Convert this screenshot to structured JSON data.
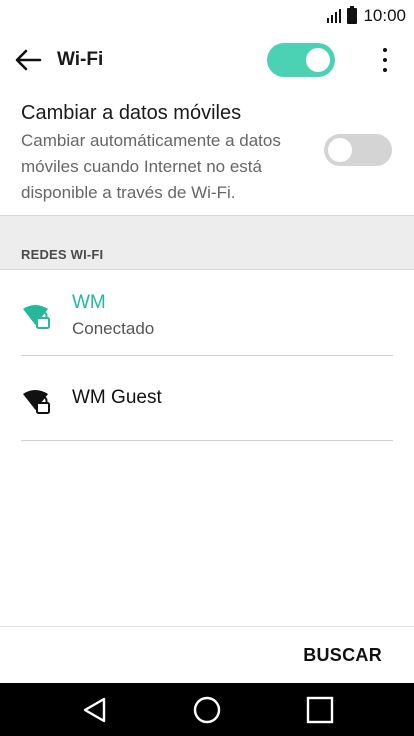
{
  "status_bar": {
    "time": "10:00",
    "icons": [
      "signal-icon",
      "battery-icon"
    ]
  },
  "app_bar": {
    "title": "Wi-Fi",
    "wifi_toggle_on": true,
    "icons": [
      "back-arrow-icon",
      "more-vert-icon"
    ]
  },
  "mobile_data_switch": {
    "title": "Cambiar a datos móviles",
    "description": "Cambiar automáticamente a datos móviles cuando Internet no está disponible a través de Wi-Fi.",
    "enabled": false
  },
  "section": {
    "header": "REDES WI-FI"
  },
  "networks": [
    {
      "name": "WM",
      "status": "Conectado",
      "connected": true,
      "locked": true,
      "color": "#26b89a"
    },
    {
      "name": "WM Guest",
      "status": "",
      "connected": false,
      "locked": true,
      "color": "#111111"
    }
  ],
  "actions": {
    "search_label": "BUSCAR"
  },
  "nav": {
    "icons": [
      "back-triangle-icon",
      "home-circle-icon",
      "recents-square-icon"
    ]
  },
  "colors": {
    "accent": "#26b89a",
    "toggle_on": "#4bd1b3",
    "toggle_off": "#d4d4d4",
    "section_bg": "#ededed"
  }
}
